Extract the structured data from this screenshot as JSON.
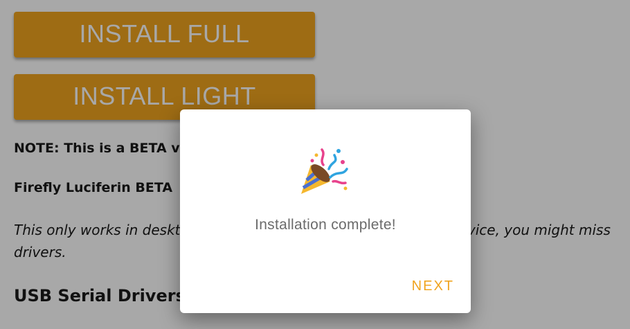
{
  "buttons": {
    "install_full": "INSTALL FULL",
    "install_light": "INSTALL LIGHT"
  },
  "notes": {
    "note1": "NOTE: This is a BETA v",
    "note2": "Firefly Luciferin BETA",
    "italic": "This only works in desktop browsers. If you can't see your ESP device, you might miss drivers.",
    "heading": "USB Serial Drivers"
  },
  "dialog": {
    "icon": "party-popper-icon",
    "message": "Installation complete!",
    "next_label": "NEXT"
  },
  "colors": {
    "accent": "#f0a41f",
    "overlay": "rgba(0,0,0,0.34)"
  }
}
